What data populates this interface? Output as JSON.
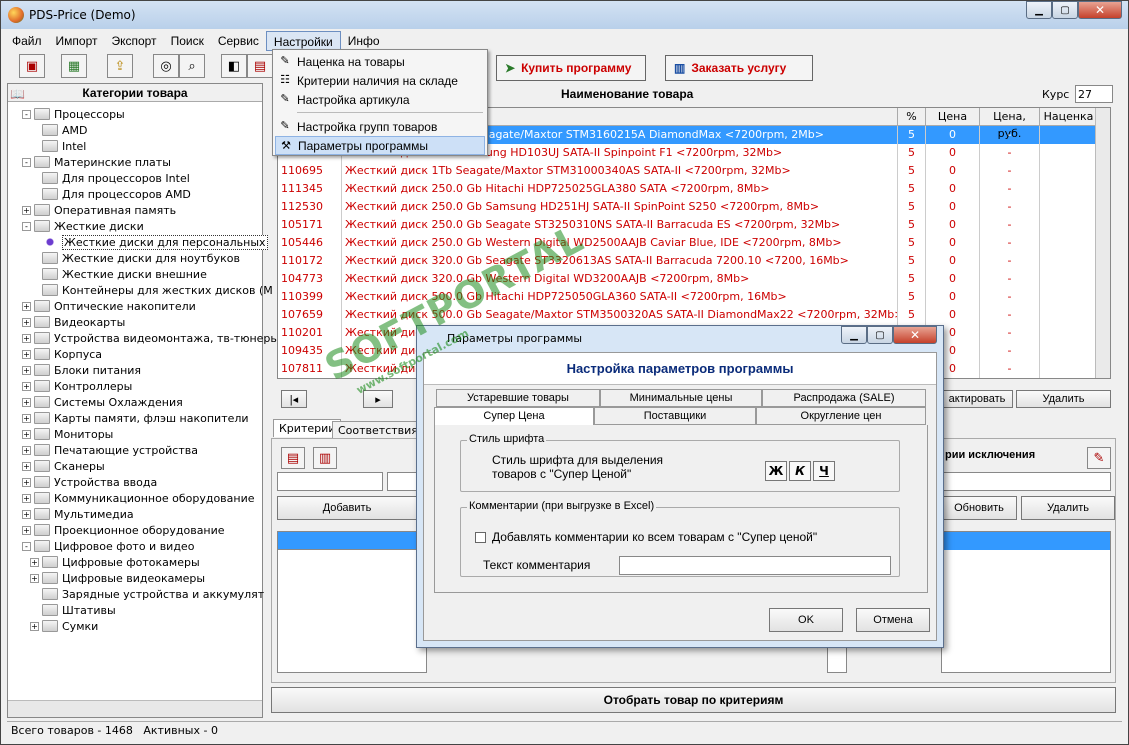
{
  "window": {
    "title": "PDS-Price (Demo)"
  },
  "menu": [
    "Файл",
    "Импорт",
    "Экспорт",
    "Поиск",
    "Сервис",
    "Настройки",
    "Инфо"
  ],
  "toolbar": {
    "buy_label": "Купить программу",
    "order_label": "Заказать услугу"
  },
  "dropdown": [
    {
      "label": "Наценка на товары",
      "icon": "markup-icon"
    },
    {
      "label": "Критерии наличия на складе",
      "icon": "stock-icon"
    },
    {
      "label": "Настройка артикула",
      "icon": "article-icon"
    },
    {
      "label": "Настройка групп товаров",
      "icon": "groups-icon"
    },
    {
      "label": "Параметры программы",
      "icon": "tools-icon"
    }
  ],
  "left": {
    "header": "Категории товара",
    "tree": [
      {
        "label": "Процессоры",
        "level": 0,
        "exp": "-"
      },
      {
        "label": "AMD",
        "level": 1,
        "exp": ""
      },
      {
        "label": "Intel",
        "level": 1,
        "exp": ""
      },
      {
        "label": "Материнские платы",
        "level": 0,
        "exp": "-"
      },
      {
        "label": "Для процессоров Intel",
        "level": 1,
        "exp": ""
      },
      {
        "label": "Для процессоров AMD",
        "level": 1,
        "exp": ""
      },
      {
        "label": "Оперативная память",
        "level": 0,
        "exp": "+"
      },
      {
        "label": "Жесткие  диски",
        "level": 0,
        "exp": "-"
      },
      {
        "label": "Жесткие диски для персональных",
        "level": 1,
        "exp": "",
        "sel": true
      },
      {
        "label": "Жесткие диски для ноутбуков",
        "level": 1,
        "exp": ""
      },
      {
        "label": "Жесткие диски внешние",
        "level": 1,
        "exp": ""
      },
      {
        "label": "Контейнеры для жестких дисков (М",
        "level": 1,
        "exp": ""
      },
      {
        "label": "Оптические накопители",
        "level": 0,
        "exp": "+"
      },
      {
        "label": "Видеокарты",
        "level": 0,
        "exp": "+"
      },
      {
        "label": "Устройства видеомонтажа, тв-тюнеры",
        "level": 0,
        "exp": "+"
      },
      {
        "label": "Корпуса",
        "level": 0,
        "exp": "+"
      },
      {
        "label": "Блоки питания",
        "level": 0,
        "exp": "+"
      },
      {
        "label": "Контроллеры",
        "level": 0,
        "exp": "+"
      },
      {
        "label": "Системы Охлаждения",
        "level": 0,
        "exp": "+"
      },
      {
        "label": "Карты памяти, флэш накопители",
        "level": 0,
        "exp": "+"
      },
      {
        "label": "Мониторы",
        "level": 0,
        "exp": "+"
      },
      {
        "label": "Печатающие устройства",
        "level": 0,
        "exp": "+"
      },
      {
        "label": "Сканеры",
        "level": 0,
        "exp": "+"
      },
      {
        "label": "Устройства ввода",
        "level": 0,
        "exp": "+"
      },
      {
        "label": "Коммуникационное оборудование",
        "level": 0,
        "exp": "+"
      },
      {
        "label": "Мультимедиа",
        "level": 0,
        "exp": "+"
      },
      {
        "label": "Проекционное оборудование",
        "level": 0,
        "exp": "+"
      },
      {
        "label": "Цифровое фото и видео",
        "level": 0,
        "exp": "-"
      },
      {
        "label": "Цифровые фотокамеры",
        "level": 1,
        "exp": "+"
      },
      {
        "label": "Цифровые видеокамеры",
        "level": 1,
        "exp": "+"
      },
      {
        "label": "Зарядные устройства и аккумулят",
        "level": 1,
        "exp": ""
      },
      {
        "label": "Штативы",
        "level": 1,
        "exp": ""
      },
      {
        "label": "Сумки",
        "level": 1,
        "exp": "+"
      }
    ]
  },
  "products": {
    "header": "Наименование товара",
    "rate_label": "Курс",
    "rate_value": "27",
    "columns": [
      "%",
      "Цена",
      "Цена, руб.",
      "Наценка"
    ],
    "rows": [
      {
        "code": "",
        "name": "Жесткий диск 160 Gb Seagate/Maxtor STM3160215A DiamondMax <7200rpm, 2Mb>",
        "pct": "5",
        "price": "0",
        "rub": "-"
      },
      {
        "code": "",
        "name": "Жесткий диск 1Tb Samsung HD103UJ SATA-II Spinpoint F1 <7200rpm, 32Mb>",
        "pct": "5",
        "price": "0",
        "rub": "-"
      },
      {
        "code": "110695",
        "name": "Жесткий диск 1Tb Seagate/Maxtor STM31000340AS SATA-II  <7200rpm, 32Mb>",
        "pct": "5",
        "price": "0",
        "rub": "-"
      },
      {
        "code": "111345",
        "name": "Жесткий диск 250.0 Gb Hitachi HDP725025GLA380 SATA <7200rpm, 8Mb>",
        "pct": "5",
        "price": "0",
        "rub": "-"
      },
      {
        "code": "112530",
        "name": "Жесткий диск 250.0 Gb Samsung HD251HJ SATA-II SpinPoint S250 <7200rpm, 8Mb>",
        "pct": "5",
        "price": "0",
        "rub": "-"
      },
      {
        "code": "105171",
        "name": "Жесткий диск 250.0 Gb Seagate ST3250310NS SATA-II Barracuda ES  <7200rpm, 32Mb>",
        "pct": "5",
        "price": "0",
        "rub": "-"
      },
      {
        "code": "105446",
        "name": "Жесткий диск 250.0 Gb Western Digital WD2500AAJB  Caviar Blue, IDE <7200rpm, 8Mb>",
        "pct": "5",
        "price": "0",
        "rub": "-"
      },
      {
        "code": "110172",
        "name": "Жесткий диск 320.0 Gb Seagate ST3320613AS SATA-II Barracuda 7200.10 <7200, 16Mb>",
        "pct": "5",
        "price": "0",
        "rub": "-"
      },
      {
        "code": "104773",
        "name": "Жесткий диск 320.0 Gb Western Digital WD3200AAJB <7200rpm, 8Mb>",
        "pct": "5",
        "price": "0",
        "rub": "-"
      },
      {
        "code": "110399",
        "name": "Жесткий диск 500.0 Gb Hitachi HDP725050GLA360 SATA-II <7200rpm, 16Mb>",
        "pct": "5",
        "price": "0",
        "rub": "-"
      },
      {
        "code": "107659",
        "name": "Жесткий диск 500.0 Gb Seagate/Maxtor STM3500320AS SATA-II DiamondMax22 <7200rpm, 32Mb>",
        "pct": "5",
        "price": "0",
        "rub": "-"
      },
      {
        "code": "110201",
        "name": "Жесткий диск",
        "pct": "5",
        "price": "0",
        "rub": "-"
      },
      {
        "code": "109435",
        "name": "Жесткий диск",
        "pct": "5",
        "price": "0",
        "rub": "-"
      },
      {
        "code": "107811",
        "name": "Жесткий диск",
        "pct": "5",
        "price": "0",
        "rub": "-"
      }
    ],
    "edit_label": "актировать",
    "delete_label": "Удалить"
  },
  "lower": {
    "tabs": [
      "Критерии",
      "Соответствия"
    ],
    "add_label": "Добавить",
    "exclusions_label": "рии исключения",
    "refresh_label": "Обновить",
    "delete_label": "Удалить",
    "filter_label": "Отобрать товар по критериям"
  },
  "dialog": {
    "window_title": "Параметры программы",
    "heading": "Настройка параметров программы",
    "tabs_row1": [
      "Устаревшие товары",
      "Минимальные цены",
      "Распродажа (SALE)"
    ],
    "tabs_row2": [
      "Супер Цена",
      "Поставщики",
      "Округление цен"
    ],
    "font_group": "Стиль шрифта",
    "font_text_1": "Стиль шрифта для выделения",
    "font_text_2": "товаров с \"Супер Ценой\"",
    "style_buttons": [
      "Ж",
      "К",
      "Ч"
    ],
    "comment_group": "Комментарии (при выгрузке в Excel)",
    "checkbox_label": "Добавлять комментарии ко всем товарам с \"Супер ценой\"",
    "comment_label": "Текст комментария",
    "comment_value": "",
    "ok_label": "OK",
    "cancel_label": "Отмена"
  },
  "status": {
    "total": "Всего товаров - 1468",
    "active": "Активных - 0"
  },
  "watermark": {
    "brand": "SOFTPORTAL",
    "url": "www.softportal.com"
  }
}
